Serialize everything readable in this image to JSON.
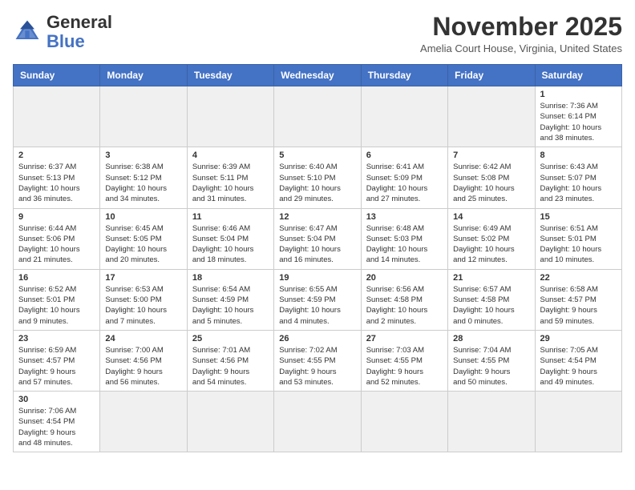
{
  "logo": {
    "text_general": "General",
    "text_blue": "Blue"
  },
  "title": "November 2025",
  "subtitle": "Amelia Court House, Virginia, United States",
  "weekdays": [
    "Sunday",
    "Monday",
    "Tuesday",
    "Wednesday",
    "Thursday",
    "Friday",
    "Saturday"
  ],
  "days": [
    {
      "num": "",
      "info": "",
      "empty": true
    },
    {
      "num": "",
      "info": "",
      "empty": true
    },
    {
      "num": "",
      "info": "",
      "empty": true
    },
    {
      "num": "",
      "info": "",
      "empty": true
    },
    {
      "num": "",
      "info": "",
      "empty": true
    },
    {
      "num": "",
      "info": "",
      "empty": true
    },
    {
      "num": "1",
      "info": "Sunrise: 7:36 AM\nSunset: 6:14 PM\nDaylight: 10 hours\nand 38 minutes."
    },
    {
      "num": "2",
      "info": "Sunrise: 6:37 AM\nSunset: 5:13 PM\nDaylight: 10 hours\nand 36 minutes."
    },
    {
      "num": "3",
      "info": "Sunrise: 6:38 AM\nSunset: 5:12 PM\nDaylight: 10 hours\nand 34 minutes."
    },
    {
      "num": "4",
      "info": "Sunrise: 6:39 AM\nSunset: 5:11 PM\nDaylight: 10 hours\nand 31 minutes."
    },
    {
      "num": "5",
      "info": "Sunrise: 6:40 AM\nSunset: 5:10 PM\nDaylight: 10 hours\nand 29 minutes."
    },
    {
      "num": "6",
      "info": "Sunrise: 6:41 AM\nSunset: 5:09 PM\nDaylight: 10 hours\nand 27 minutes."
    },
    {
      "num": "7",
      "info": "Sunrise: 6:42 AM\nSunset: 5:08 PM\nDaylight: 10 hours\nand 25 minutes."
    },
    {
      "num": "8",
      "info": "Sunrise: 6:43 AM\nSunset: 5:07 PM\nDaylight: 10 hours\nand 23 minutes."
    },
    {
      "num": "9",
      "info": "Sunrise: 6:44 AM\nSunset: 5:06 PM\nDaylight: 10 hours\nand 21 minutes."
    },
    {
      "num": "10",
      "info": "Sunrise: 6:45 AM\nSunset: 5:05 PM\nDaylight: 10 hours\nand 20 minutes."
    },
    {
      "num": "11",
      "info": "Sunrise: 6:46 AM\nSunset: 5:04 PM\nDaylight: 10 hours\nand 18 minutes."
    },
    {
      "num": "12",
      "info": "Sunrise: 6:47 AM\nSunset: 5:04 PM\nDaylight: 10 hours\nand 16 minutes."
    },
    {
      "num": "13",
      "info": "Sunrise: 6:48 AM\nSunset: 5:03 PM\nDaylight: 10 hours\nand 14 minutes."
    },
    {
      "num": "14",
      "info": "Sunrise: 6:49 AM\nSunset: 5:02 PM\nDaylight: 10 hours\nand 12 minutes."
    },
    {
      "num": "15",
      "info": "Sunrise: 6:51 AM\nSunset: 5:01 PM\nDaylight: 10 hours\nand 10 minutes."
    },
    {
      "num": "16",
      "info": "Sunrise: 6:52 AM\nSunset: 5:01 PM\nDaylight: 10 hours\nand 9 minutes."
    },
    {
      "num": "17",
      "info": "Sunrise: 6:53 AM\nSunset: 5:00 PM\nDaylight: 10 hours\nand 7 minutes."
    },
    {
      "num": "18",
      "info": "Sunrise: 6:54 AM\nSunset: 4:59 PM\nDaylight: 10 hours\nand 5 minutes."
    },
    {
      "num": "19",
      "info": "Sunrise: 6:55 AM\nSunset: 4:59 PM\nDaylight: 10 hours\nand 4 minutes."
    },
    {
      "num": "20",
      "info": "Sunrise: 6:56 AM\nSunset: 4:58 PM\nDaylight: 10 hours\nand 2 minutes."
    },
    {
      "num": "21",
      "info": "Sunrise: 6:57 AM\nSunset: 4:58 PM\nDaylight: 10 hours\nand 0 minutes."
    },
    {
      "num": "22",
      "info": "Sunrise: 6:58 AM\nSunset: 4:57 PM\nDaylight: 9 hours\nand 59 minutes."
    },
    {
      "num": "23",
      "info": "Sunrise: 6:59 AM\nSunset: 4:57 PM\nDaylight: 9 hours\nand 57 minutes."
    },
    {
      "num": "24",
      "info": "Sunrise: 7:00 AM\nSunset: 4:56 PM\nDaylight: 9 hours\nand 56 minutes."
    },
    {
      "num": "25",
      "info": "Sunrise: 7:01 AM\nSunset: 4:56 PM\nDaylight: 9 hours\nand 54 minutes."
    },
    {
      "num": "26",
      "info": "Sunrise: 7:02 AM\nSunset: 4:55 PM\nDaylight: 9 hours\nand 53 minutes."
    },
    {
      "num": "27",
      "info": "Sunrise: 7:03 AM\nSunset: 4:55 PM\nDaylight: 9 hours\nand 52 minutes."
    },
    {
      "num": "28",
      "info": "Sunrise: 7:04 AM\nSunset: 4:55 PM\nDaylight: 9 hours\nand 50 minutes."
    },
    {
      "num": "29",
      "info": "Sunrise: 7:05 AM\nSunset: 4:54 PM\nDaylight: 9 hours\nand 49 minutes."
    },
    {
      "num": "30",
      "info": "Sunrise: 7:06 AM\nSunset: 4:54 PM\nDaylight: 9 hours\nand 48 minutes."
    },
    {
      "num": "",
      "info": "",
      "empty": true
    },
    {
      "num": "",
      "info": "",
      "empty": true
    },
    {
      "num": "",
      "info": "",
      "empty": true
    },
    {
      "num": "",
      "info": "",
      "empty": true
    },
    {
      "num": "",
      "info": "",
      "empty": true
    },
    {
      "num": "",
      "info": "",
      "empty": true
    }
  ]
}
